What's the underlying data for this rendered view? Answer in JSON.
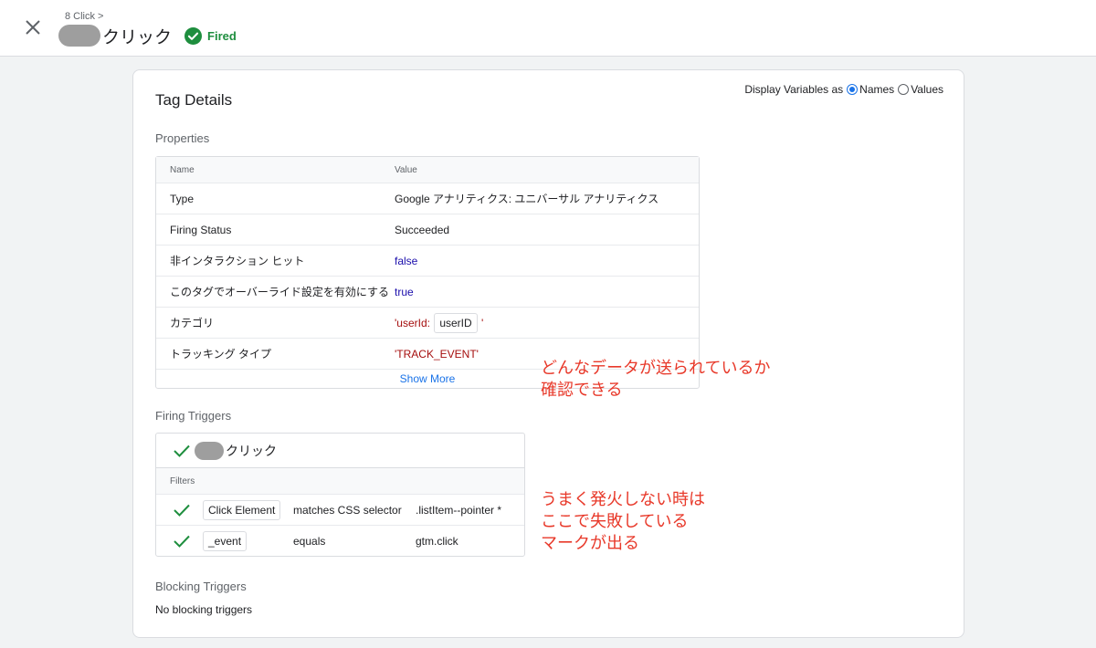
{
  "header": {
    "breadcrumb": "8 Click >",
    "title": "クリック",
    "status": "Fired",
    "status_color": "#1e8e3e",
    "close_icon": "close-icon",
    "status_icon": "check-circle-icon"
  },
  "card": {
    "title": "Tag Details",
    "display_variables": {
      "label": "Display Variables as",
      "options": [
        "Names",
        "Values"
      ],
      "selected": "Names"
    }
  },
  "properties": {
    "label": "Properties",
    "columns": [
      "Name",
      "Value"
    ],
    "rows": [
      {
        "name": "Type",
        "value": "Google アナリティクス: ユニバーサル アナリティクス"
      },
      {
        "name": "Firing Status",
        "value": "Succeeded"
      },
      {
        "name": "非インタラクション ヒット",
        "value": "false"
      },
      {
        "name": "このタグでオーバーライド設定を有効にする",
        "value": "true"
      },
      {
        "name": "カテゴリ",
        "value_prefix": "'userId:",
        "value_chip": "userID",
        "value_suffix": "'"
      },
      {
        "name": "トラッキング タイプ",
        "value": "'TRACK_EVENT'"
      }
    ],
    "show_more": "Show More"
  },
  "firing_triggers": {
    "label": "Firing Triggers",
    "trigger_name": "クリック",
    "filters_label": "Filters",
    "filters": [
      {
        "variable": "Click Element",
        "operator": "matches CSS selector",
        "value": ".listItem--pointer *"
      },
      {
        "variable": "_event",
        "operator": "equals",
        "value": "gtm.click"
      }
    ]
  },
  "blocking_triggers": {
    "label": "Blocking Triggers",
    "text": "No blocking triggers"
  },
  "annotations": {
    "first": "どんなデータが送られているか\n確認できる",
    "second": "うまく発火しない時は\nここで失敗している\nマークが出る",
    "color": "#e8392a"
  }
}
